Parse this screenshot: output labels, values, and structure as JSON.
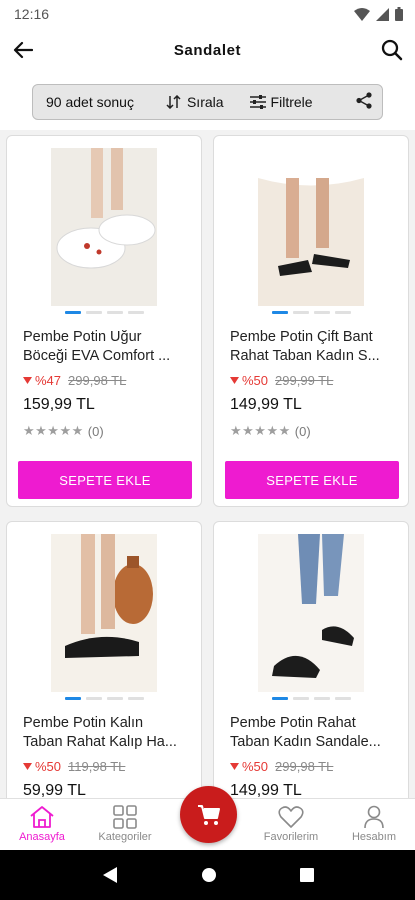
{
  "status_bar": {
    "time": "12:16"
  },
  "header": {
    "title": "Sandalet"
  },
  "toolbar": {
    "result_count": "90 adet sonuç",
    "sort_label": "Sırala",
    "filter_label": "Filtrele"
  },
  "products": [
    {
      "name_line1": "Pembe Potin Uğur",
      "name_line2": "Böceği EVA Comfort ...",
      "discount": "%47",
      "old_price": "299,98 TL",
      "price": "159,99 TL",
      "stars": "★★★★★",
      "reviews": "(0)",
      "add_label": "SEPETE EKLE"
    },
    {
      "name_line1": "Pembe Potin Çift Bant",
      "name_line2": "Rahat Taban Kadın S...",
      "discount": "%50",
      "old_price": "299,99 TL",
      "price": "149,99 TL",
      "stars": "★★★★★",
      "reviews": "(0)",
      "add_label": "SEPETE EKLE"
    },
    {
      "name_line1": "Pembe Potin Kalın",
      "name_line2": "Taban Rahat Kalıp Ha...",
      "discount": "%50",
      "old_price": "119,98 TL",
      "price": "59,99 TL"
    },
    {
      "name_line1": "Pembe Potin Rahat",
      "name_line2": "Taban Kadın Sandale...",
      "discount": "%50",
      "old_price": "299,98 TL",
      "price": "149,99 TL"
    }
  ],
  "bottom_nav": [
    {
      "label": "Anasayfa",
      "icon": "home-icon"
    },
    {
      "label": "Kategoriler",
      "icon": "grid-icon"
    },
    {
      "label": "",
      "icon": "cart-icon"
    },
    {
      "label": "Favorilerim",
      "icon": "heart-icon"
    },
    {
      "label": "Hesabım",
      "icon": "user-icon"
    }
  ],
  "colors": {
    "accent": "#ee1bd0",
    "cart_fab": "#c91c1c",
    "discount": "#e53935",
    "dot_active": "#1e88e5"
  }
}
